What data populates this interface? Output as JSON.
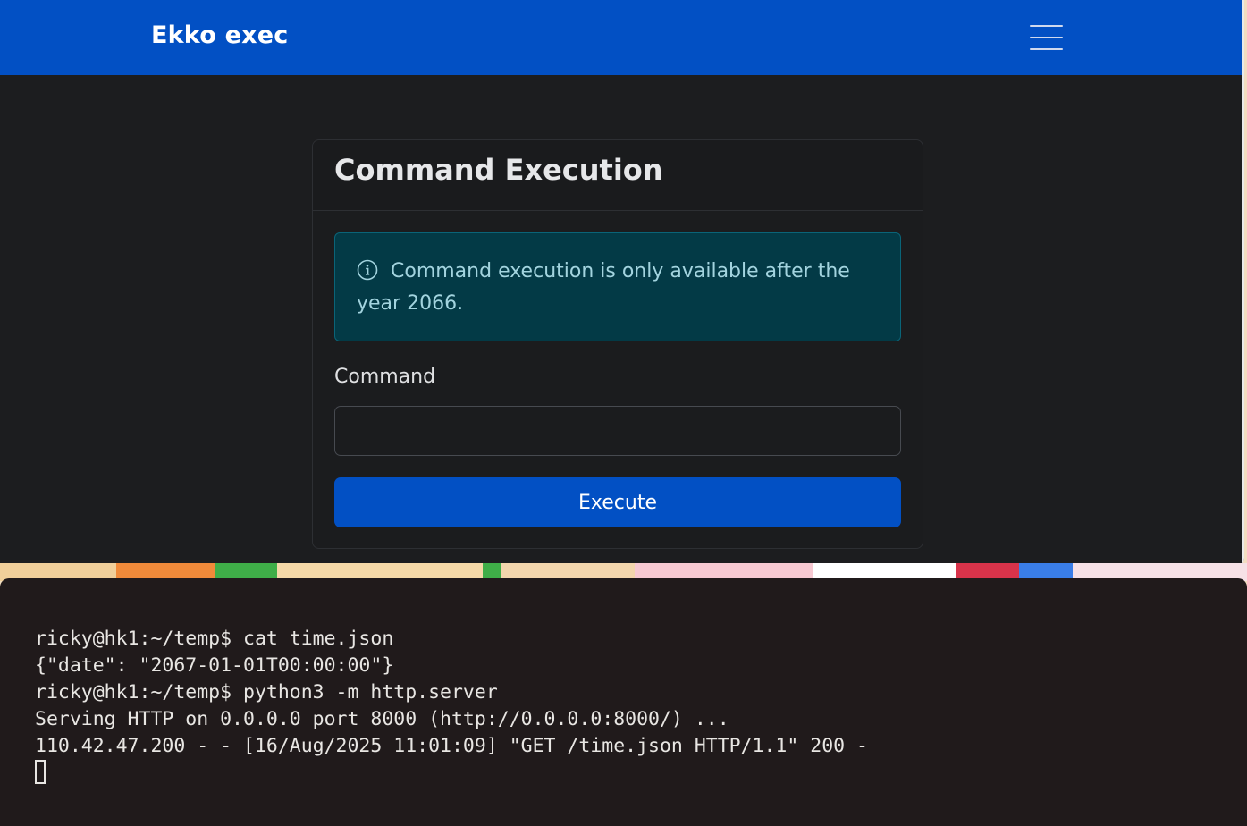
{
  "navbar": {
    "brand": "Ekko exec"
  },
  "card": {
    "title": "Command Execution",
    "alert_text": "Command execution is only available after the year 2066.",
    "command_label": "Command",
    "command_value": "",
    "command_placeholder": "",
    "execute_label": "Execute"
  },
  "colors": {
    "navbar": "#0250c4",
    "page_bg": "#1c1d1f",
    "alert_bg": "#033a46",
    "button": "#0250c4",
    "terminal_bg": "#201a1b"
  },
  "icons": {
    "alert": "info-circle-icon",
    "menu": "hamburger-icon"
  },
  "terminal": {
    "lines": [
      "ricky@hk1:~/temp$ cat time.json",
      "{\"date\": \"2067-01-01T00:00:00\"}",
      "ricky@hk1:~/temp$ python3 -m http.server",
      "Serving HTTP on 0.0.0.0 port 8000 (http://0.0.0.0:8000/) ...",
      "110.42.47.200 - - [16/Aug/2025 11:01:09] \"GET /time.json HTTP/1.1\" 200 -"
    ]
  }
}
